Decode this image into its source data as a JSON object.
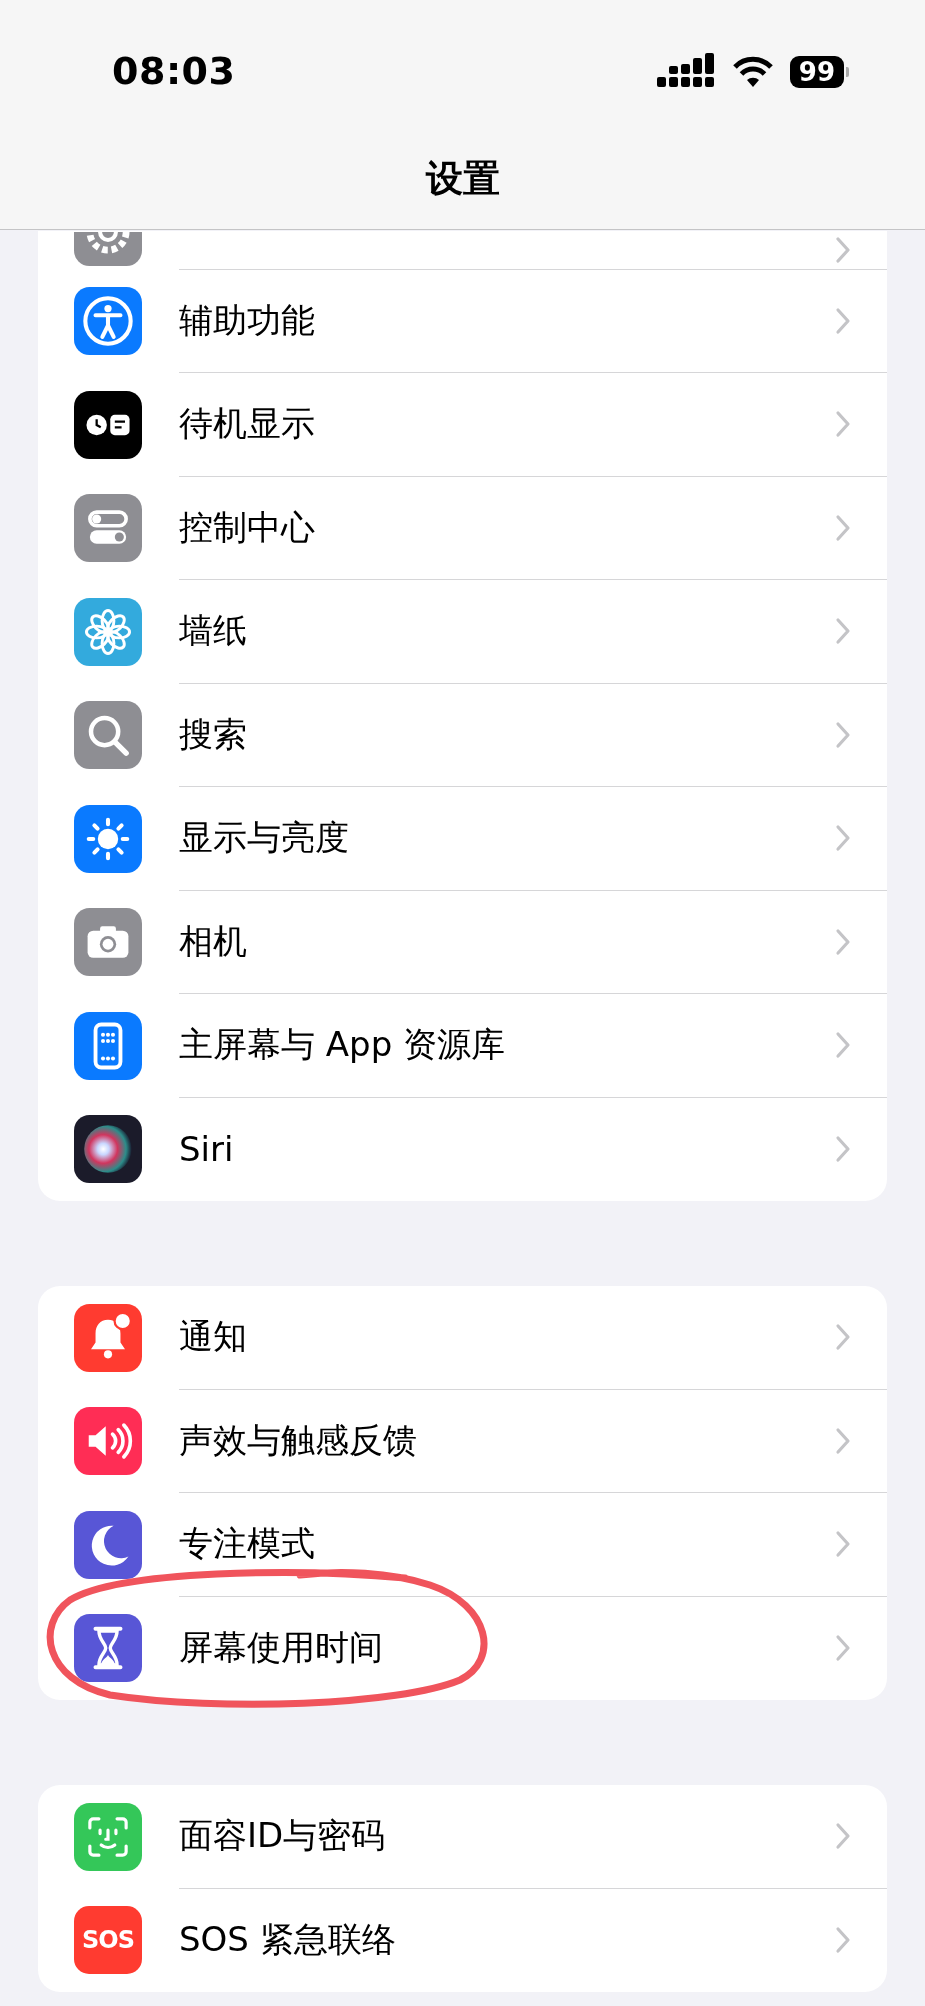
{
  "status_bar": {
    "time": "08:03",
    "battery": "99"
  },
  "nav_bar": {
    "title": "设置"
  },
  "groups": [
    {
      "rows": [
        {
          "kind": "gear"
        },
        {
          "kind": "accessibility",
          "label": "辅助功能"
        },
        {
          "kind": "standby",
          "label": "待机显示"
        },
        {
          "kind": "controls",
          "label": "控制中心"
        },
        {
          "kind": "flower",
          "label": "墙纸"
        },
        {
          "kind": "search",
          "label": "搜索"
        },
        {
          "kind": "sun",
          "label": "显示与亮度"
        },
        {
          "kind": "camera",
          "label": "相机"
        },
        {
          "kind": "phone",
          "label": "主屏幕与 App 资源库"
        },
        {
          "kind": "orb",
          "label": "Siri"
        }
      ]
    },
    {
      "rows": [
        {
          "kind": "bell",
          "label": "通知"
        },
        {
          "kind": "speaker",
          "label": "声效与触感反馈"
        },
        {
          "kind": "moon",
          "label": "专注模式"
        },
        {
          "kind": "hourglass",
          "label": "屏幕使用时间",
          "circled": true
        }
      ]
    },
    {
      "rows": [
        {
          "kind": "face",
          "label": "面容ID与密码"
        },
        {
          "kind": "text",
          "icon_text": "SOS",
          "label": "SOS 紧急联络"
        }
      ]
    }
  ]
}
